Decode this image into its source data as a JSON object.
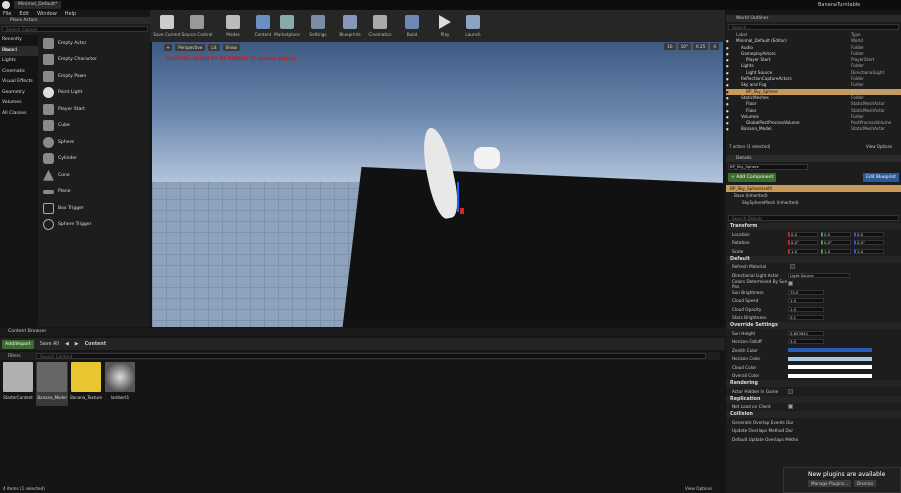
{
  "window": {
    "tab": "Minimal_Default*",
    "project": "BananaTurntable"
  },
  "menu": [
    "File",
    "Edit",
    "Window",
    "Help"
  ],
  "toolbar": [
    "Save Current",
    "Source Control",
    "Modes",
    "Content",
    "Marketplace",
    "Settings",
    "Blueprints",
    "Cinematics",
    "Build",
    "Play",
    "Launch"
  ],
  "place_actors": {
    "title": "Place Actors",
    "search_placeholder": "Search Classes",
    "categories": [
      "Recently Placed",
      "Basic",
      "Lights",
      "Cinematic",
      "Visual Effects",
      "Geometry",
      "Volumes",
      "All Classes"
    ],
    "actors": [
      "Empty Actor",
      "Empty Character",
      "Empty Pawn",
      "Point Light",
      "Player Start",
      "Cube",
      "Sphere",
      "Cylinder",
      "Cone",
      "Plane",
      "Box Trigger",
      "Sphere Trigger"
    ]
  },
  "viewport": {
    "perspective": "Perspective",
    "lit": "Lit",
    "show": "Show",
    "warning": "LIGHTING NEEDS TO BE REBUILT (1 unbuilt object)",
    "grid": "10",
    "angle": "10°",
    "scale": "0.25",
    "cam": "4"
  },
  "content_browser": {
    "tab": "Content Browser",
    "add_import": "Add/Import",
    "save_all": "Save All",
    "path": "Content",
    "filters": "Filters",
    "search_placeholder": "Search Content",
    "assets": [
      "StarterContent",
      "Banana_Model",
      "Banana_Texture",
      "lambert1"
    ],
    "status": "4 items (1 selected)",
    "view_options": "View Options"
  },
  "outliner": {
    "title": "World Outliner",
    "search_placeholder": "Search...",
    "col_label": "Label",
    "col_type": "Type",
    "rows": [
      {
        "label": "Minimal_Default (Editor)",
        "type": "World"
      },
      {
        "label": "Audio",
        "type": "Folder"
      },
      {
        "label": "GameplayActors",
        "type": "Folder"
      },
      {
        "label": "Player Start",
        "type": "PlayerStart"
      },
      {
        "label": "Lights",
        "type": "Folder"
      },
      {
        "label": "Light Source",
        "type": "DirectionalLight"
      },
      {
        "label": "ReflectionCaptureActors",
        "type": "Folder"
      },
      {
        "label": "Sky and Fog",
        "type": "Folder"
      },
      {
        "label": "BP_Sky_Sphere",
        "type": "Edit BP_Sky_Sphere"
      },
      {
        "label": "StaticMeshes",
        "type": "Folder"
      },
      {
        "label": "Floor",
        "type": "StaticMeshActor"
      },
      {
        "label": "Floor",
        "type": "StaticMeshActor"
      },
      {
        "label": "Volumes",
        "type": "Folder"
      },
      {
        "label": "GlobalPostProcessVolume",
        "type": "PostProcessVolume"
      },
      {
        "label": "Banana_Model",
        "type": "StaticMeshActor"
      }
    ],
    "status": "7 actors (1 selected)",
    "view_options": "View Options"
  },
  "details": {
    "title": "Details",
    "name": "BP_Sky_Sphere",
    "add_component": "+ Add Component",
    "edit_bp": "Edit Blueprint",
    "self": "BP_Sky_Sphere(self)",
    "base": "Base (Inherited)",
    "mesh": "SkySphereMesh (Inherited)",
    "search_placeholder": "Search Details",
    "transform": "Transform",
    "location": {
      "label": "Location",
      "x": "0.0",
      "y": "0.0",
      "z": "0.0"
    },
    "rotation": {
      "label": "Rotation",
      "x": "0.0°",
      "y": "0.0°",
      "z": "0.0°"
    },
    "scale": {
      "label": "Scale",
      "x": "1.0",
      "y": "1.0",
      "z": "1.0"
    },
    "default": "Default",
    "refresh": "Refresh Material",
    "dla": "Directional Light Actor",
    "dla_val": "Light Source",
    "colors_by_sun": "Colors Determined By Sun Pos",
    "sun_brightness": {
      "label": "Sun Brightness",
      "val": "75.0"
    },
    "cloud_speed": {
      "label": "Cloud Speed",
      "val": "1.0"
    },
    "cloud_opacity": {
      "label": "Cloud Opacity",
      "val": "1.0"
    },
    "stars": {
      "label": "Stars Brightness",
      "val": "0.1"
    },
    "override": "Override Settings",
    "sun_height": {
      "label": "Sun Height",
      "val": "0.633941"
    },
    "horizon_falloff": {
      "label": "Horizon Falloff",
      "val": "3.0"
    },
    "zenith": "Zenith Color",
    "horizon": "Horizon Color",
    "cloud_color": "Cloud Color",
    "overall": "Overall Color",
    "rendering": "Rendering",
    "hidden": "Actor Hidden In Game",
    "replication": "Replication",
    "net_load": "Net Load on Client",
    "collision": "Collision",
    "gen_overlap": "Generate Overlap Events Dur",
    "upd_overlap": "Update Overlaps Method Dur",
    "def_overlap": "Default Update Overlaps Metho"
  },
  "notification": {
    "title": "New plugins are available",
    "manage": "Manage Plugins...",
    "dismiss": "Dismiss"
  }
}
